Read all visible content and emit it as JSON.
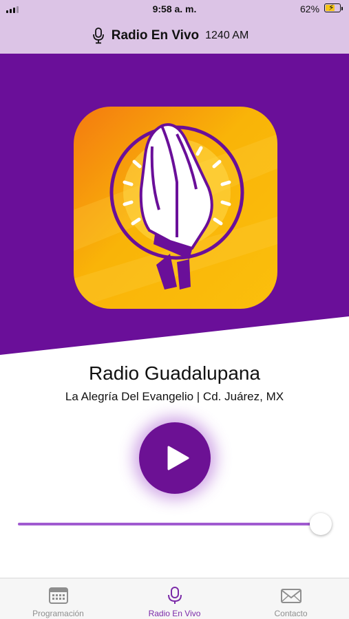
{
  "status_bar": {
    "time": "9:58 a. m.",
    "battery_percent": "62%",
    "battery_level": 0.62,
    "charging": true
  },
  "nav": {
    "title": "Radio En Vivo",
    "frequency": "1240 AM",
    "icon": "microphone-icon"
  },
  "station": {
    "name": "Radio Guadalupana",
    "tagline": "La Alegría Del Evangelio | Cd. Juárez, MX",
    "logo_icon": "praying-hands-logo"
  },
  "player": {
    "play_icon": "play-icon",
    "volume_level": 0.95
  },
  "tabs": [
    {
      "label": "Programación",
      "icon": "calendar-icon",
      "active": false
    },
    {
      "label": "Radio En Vivo",
      "icon": "microphone-icon",
      "active": true
    },
    {
      "label": "Contacto",
      "icon": "mail-icon",
      "active": false
    }
  ],
  "colors": {
    "header_bg": "#dcc4e6",
    "brand_purple": "#6a0f99",
    "logo_yellow": "#f9b408",
    "logo_orange": "#f48c10",
    "accent": "#7b2aa8"
  }
}
